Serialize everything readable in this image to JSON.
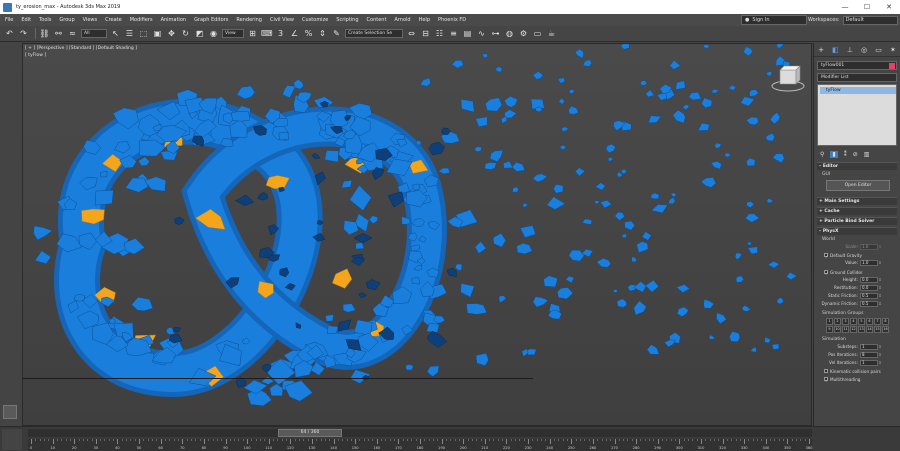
{
  "window": {
    "title": "ty_erosion_max - Autodesk 3ds Max 2019",
    "minimize": "—",
    "maximize": "☐",
    "close": "✕"
  },
  "menus": [
    "File",
    "Edit",
    "Tools",
    "Group",
    "Views",
    "Create",
    "Modifiers",
    "Animation",
    "Graph Editors",
    "Rendering",
    "Civil View",
    "Customize",
    "Scripting",
    "Content",
    "Arnold",
    "Help",
    "Phoenix FD"
  ],
  "account": {
    "sign_in": "Sign In",
    "workspaces_label": "Workspaces:",
    "workspace_value": "Default"
  },
  "toolbar": {
    "filter_value": "All",
    "view_value": "View",
    "selection_set_placeholder": "Create Selection Se"
  },
  "viewport": {
    "label": "[ + ] [Perspective ] [Standard ] [Default Shading ]",
    "object_label": "[ tyFlow ]"
  },
  "command_panel": {
    "object_name": "tyFlow001",
    "modifier_list": "Modifier List",
    "stack_item": "tyFlow",
    "rollouts": {
      "editor": "Editor",
      "gui": "GUI",
      "open_editor": "Open Editor",
      "main_settings": "Main Settings",
      "cache": "Cache",
      "particle_bind_solver": "Particle Bind Solver",
      "physx": "PhysX",
      "world": "World"
    },
    "params": {
      "scale": {
        "label": "Scale:",
        "value": "1.0"
      },
      "default_gravity": "Default Gravity",
      "value": {
        "label": "Value:",
        "value": "1.0"
      },
      "ground_collider": "Ground Collider",
      "height": {
        "label": "Height:",
        "value": "0.0"
      },
      "restitution": {
        "label": "Restitution:",
        "value": "0.0"
      },
      "static_friction": {
        "label": "Static Friction:",
        "value": "0.5"
      },
      "dynamic_friction": {
        "label": "Dynamic Friction:",
        "value": "0.5"
      },
      "simulation_groups": "Simulation Groups",
      "groups": [
        "1",
        "2",
        "3",
        "4",
        "5",
        "6",
        "7",
        "8",
        "9",
        "10",
        "11",
        "12",
        "13",
        "14",
        "15",
        "16"
      ],
      "simulation": "Simulation",
      "substeps": {
        "label": "Substeps:",
        "value": "1"
      },
      "pos_iterations": {
        "label": "Pos Iterations:",
        "value": "8"
      },
      "vel_iterations": {
        "label": "Vel Iterations:",
        "value": "1"
      },
      "kinematic_collision_pairs": "Kinematic collision pairs",
      "multithreading": "Multithreading"
    }
  },
  "timeline": {
    "frame_display": "64 / 360",
    "ticks": [
      "0",
      "10",
      "20",
      "30",
      "40",
      "50",
      "60",
      "70",
      "80",
      "90",
      "100",
      "110",
      "120",
      "130",
      "140",
      "150",
      "160",
      "170",
      "180",
      "190",
      "200",
      "210",
      "220",
      "230",
      "240",
      "250",
      "260",
      "270",
      "280",
      "290",
      "300",
      "310",
      "320",
      "330",
      "340",
      "350",
      "360"
    ]
  },
  "colors": {
    "fragment_blue": "#1a7fdc",
    "fragment_orange": "#f3a51b",
    "accent": "#3d7fc4"
  }
}
